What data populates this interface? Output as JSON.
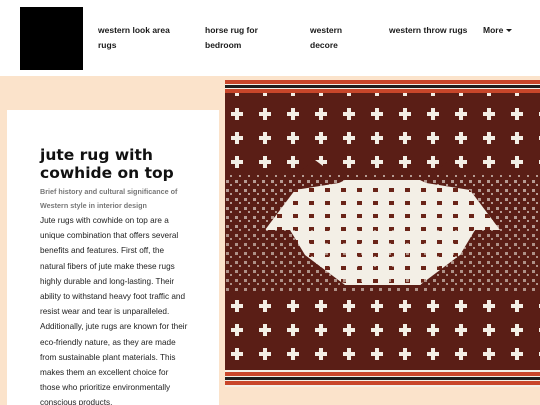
{
  "nav": {
    "items": [
      {
        "label": "western look area rugs"
      },
      {
        "label": "horse rug for bedroom"
      },
      {
        "label": "western decore"
      },
      {
        "label": "western throw rugs"
      }
    ],
    "more_label": "More"
  },
  "article": {
    "title": "jute rug with cowhide on top",
    "subtitle": "Brief history and cultural significance of Western style in interior design",
    "body": "Jute rugs with cowhide on top are a unique combination that offers several benefits and features. First off, the natural fibers of jute make these rugs highly durable and long-lasting. Their ability to withstand heavy foot traffic and resist wear and tear is unparalleled. Additionally, jute rugs are known for their eco-friendly nature, as they are made from sustainable plant materials. This makes them an excellent choice for those who prioritize environmentally conscious products."
  },
  "colors": {
    "accent_background": "#fbe3cb",
    "rug_dark": "#5a1e16",
    "rug_light": "#f3efe6",
    "rug_border": "#c8462a"
  }
}
